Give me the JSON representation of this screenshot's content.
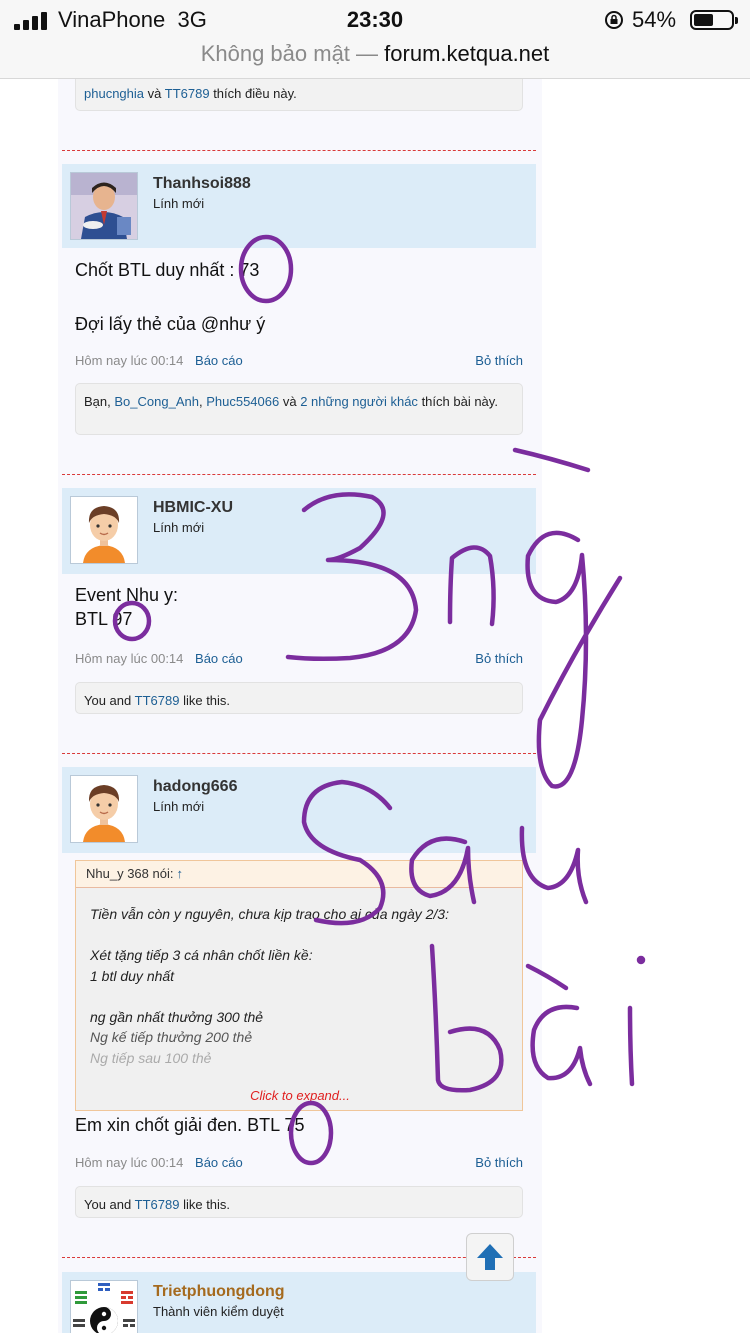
{
  "status_bar": {
    "carrier": "VinaPhone",
    "network": "3G",
    "time": "23:30",
    "battery_percent": "54%",
    "battery_level": 0.54
  },
  "url_bar": {
    "insecure_label": "Không bảo mật —",
    "domain": "forum.ketqua.net"
  },
  "colors": {
    "link": "#1d5f94",
    "post_header_bg": "#dcecf8",
    "divider": "#d93a3a",
    "handwriting": "#7b2d9e"
  },
  "top_like_box": {
    "user1": "phucnghia",
    "and": "và",
    "user2": "TT6789",
    "suffix": "thích điều này."
  },
  "posts": [
    {
      "username": "Thanhsoi888",
      "title": "Lính mới",
      "lines": [
        "Chốt BTL duy nhất : 73",
        "Đợi lấy thẻ của @như ý"
      ],
      "date": "Hôm nay lúc 00:14",
      "report": "Báo cáo",
      "like": "Bỏ thích",
      "likes": {
        "prefix": "Bạn,",
        "user1": "Bo_Cong_Anh",
        "sep": ",",
        "user2": "Phuc554066",
        "and": "và",
        "others": "2 những người khác",
        "suffix": "thích bài này."
      }
    },
    {
      "username": "HBMIC-XU",
      "title": "Lính mới",
      "lines": [
        "Event Nhu y:",
        "BTL 97"
      ],
      "date": "Hôm nay lúc 00:14",
      "report": "Báo cáo",
      "like": "Bỏ thích",
      "likes": {
        "prefix": "You and",
        "user": "TT6789",
        "suffix": "like this."
      }
    },
    {
      "username": "hadong666",
      "title": "Lính mới",
      "quote": {
        "author": "Nhu_y 368 nói:",
        "arrow": "↑",
        "lines": [
          "Tiền vẫn còn y nguyên, chưa kịp trao cho ai của ngày 2/3:",
          "",
          "Xét tặng tiếp 3 cá nhân chốt liền kề:",
          "1 btl duy nhất",
          "",
          "ng gần nhất thưởng 300 thẻ",
          "Ng kế tiếp thưởng 200 thẻ",
          "Ng tiếp sau 100 thẻ"
        ],
        "expand": "Click to expand..."
      },
      "lines": [
        "Em xin chốt giải đen. BTL 75"
      ],
      "date": "Hôm nay lúc 00:14",
      "report": "Báo cáo",
      "like": "Bỏ thích",
      "likes": {
        "prefix": "You and",
        "user": "TT6789",
        "suffix": "like this."
      }
    },
    {
      "username": "Trietphuongdong",
      "title": "Thành viên kiểm duyệt"
    }
  ],
  "scroll_top_icon": "arrow-up-icon",
  "handwriting": [
    "3 ngày",
    "Sau",
    "bài"
  ]
}
